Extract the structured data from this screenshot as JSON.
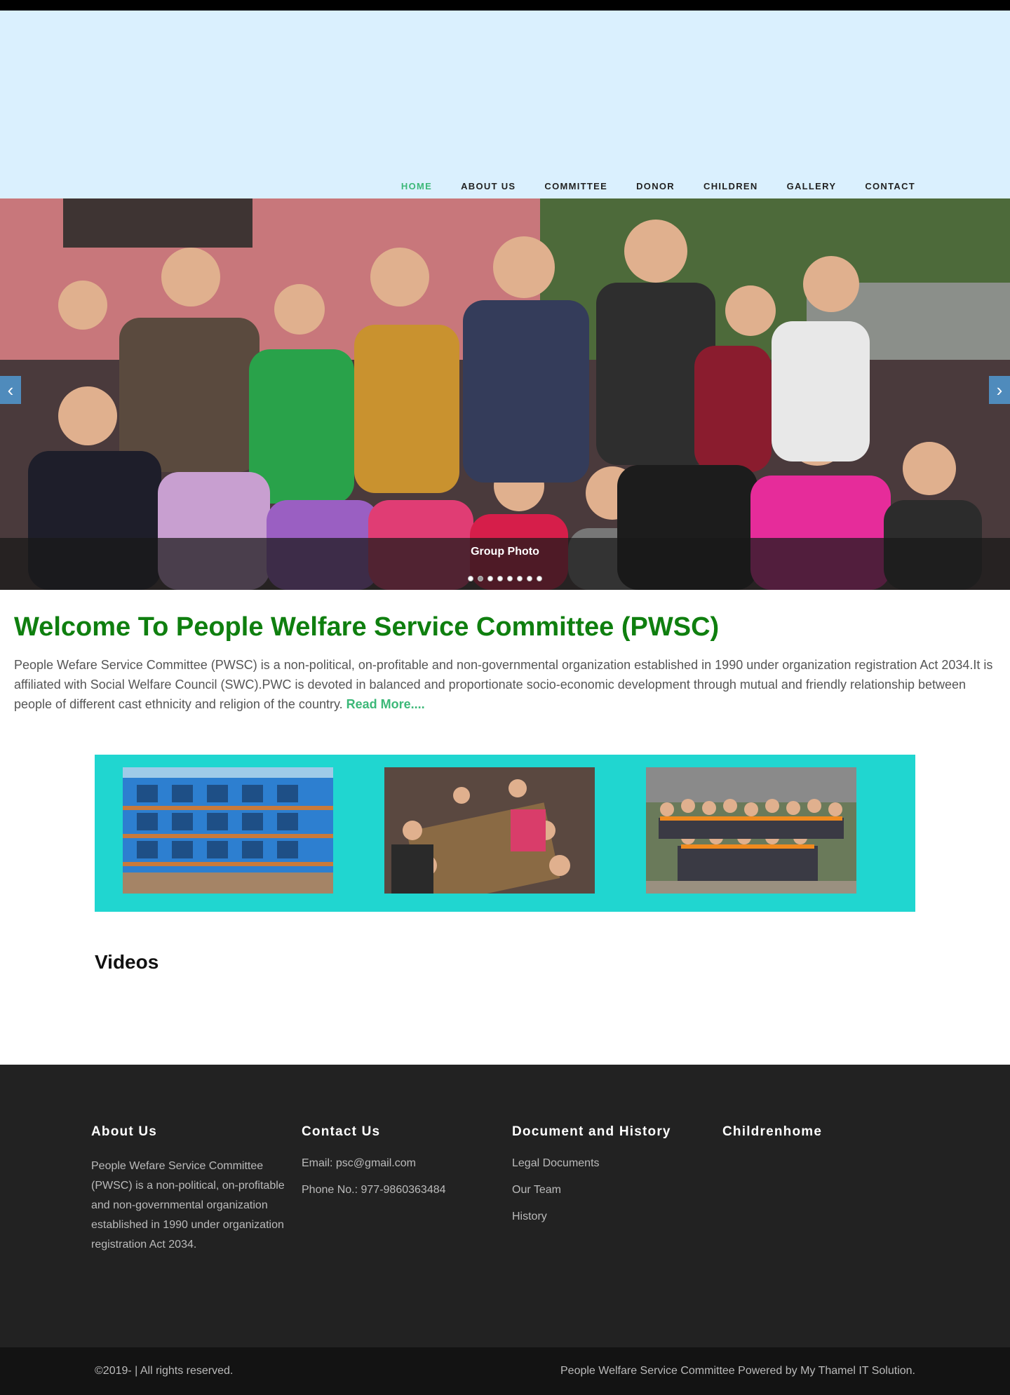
{
  "nav": {
    "items": [
      {
        "label": "HOME",
        "active": true
      },
      {
        "label": "ABOUT US"
      },
      {
        "label": "COMMITTEE"
      },
      {
        "label": "DONOR"
      },
      {
        "label": "CHILDREN"
      },
      {
        "label": "GALLERY"
      },
      {
        "label": "CONTACT"
      }
    ]
  },
  "slider": {
    "caption": "Group Photo",
    "prev_icon": "chevron-left-icon",
    "next_icon": "chevron-right-icon",
    "dot_count": 8,
    "active_dot": 2
  },
  "welcome": {
    "title": "Welcome To People Welfare Service Committee (PWSC)",
    "body": "People Wefare Service Committee (PWSC) is a non-political, on-profitable and non-governmental organization established in 1990 under organization registration Act 2034.It is affiliated with Social Welfare Council (SWC).PWC is devoted in balanced and proportionate socio-economic development through mutual and friendly relationship between people of different cast ethnicity and religion of the country.",
    "read_more": "Read More...."
  },
  "gallery": {
    "background": "#20d6d0"
  },
  "videos": {
    "heading": "Videos"
  },
  "footer": {
    "about": {
      "heading": "About Us",
      "text": "People Wefare Service Committee (PWSC) is a non-political, on-profitable and non-governmental organization established in 1990 under organization registration Act 2034."
    },
    "contact": {
      "heading": "Contact Us",
      "email": "Email: psc@gmail.com",
      "phone": "Phone No.: 977-9860363484"
    },
    "documents": {
      "heading": "Document and History",
      "links": [
        "Legal Documents",
        "Our Team",
        "History"
      ]
    },
    "children": {
      "heading": "Childrenhome"
    }
  },
  "bottombar": {
    "copyright": "©2019- | All rights reserved.",
    "credits": "People Welfare Service Committee Powered by My Thamel IT Solution."
  },
  "colors": {
    "accent_green": "#3cb878",
    "title_green": "#0f7f0f",
    "header_bg": "#daf0fe",
    "footer_bg": "#222222"
  }
}
